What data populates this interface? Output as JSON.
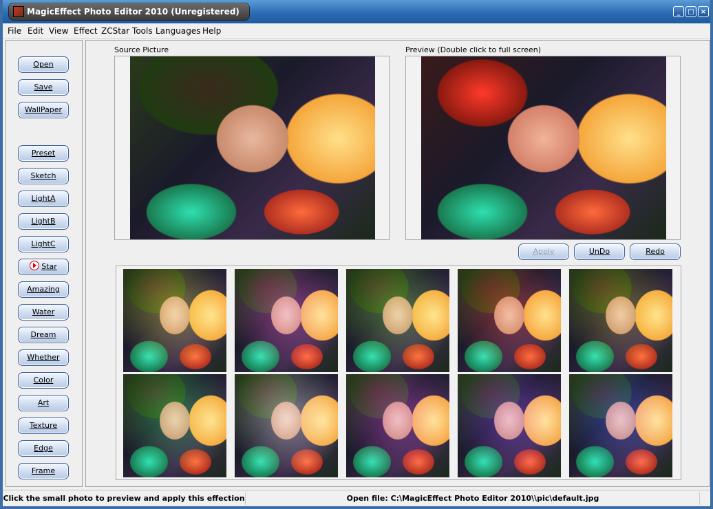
{
  "window": {
    "title": "MagicEffect Photo Editor 2010 (Unregistered)",
    "controls": [
      "_",
      "□",
      "×"
    ]
  },
  "menu": [
    {
      "label": "File"
    },
    {
      "label": "Edit"
    },
    {
      "label": "View"
    },
    {
      "label": "Effect"
    },
    {
      "label": "ZCStar Tools"
    },
    {
      "label": "Languages"
    },
    {
      "label": "Help"
    }
  ],
  "sidebar": {
    "file_buttons": [
      "Open",
      "Save",
      "WallPaper"
    ],
    "effect_buttons": [
      "Preset",
      "Sketch",
      "LightA",
      "LightB",
      "LightC",
      "Star",
      "Amazing",
      "Water",
      "Dream",
      "Whether",
      "Color",
      "Art",
      "Texture",
      "Edge",
      "Frame"
    ],
    "selected": "Star"
  },
  "source": {
    "label": "Source Picture"
  },
  "preview": {
    "label": "Preview (Double click to full screen)"
  },
  "actions": {
    "apply": "Apply",
    "undo": "UnDo",
    "redo": "Redo"
  },
  "thumbnails": [
    {
      "tint": "#f2e23c"
    },
    {
      "tint": "#ff4fd8"
    },
    {
      "tint": "#7fd43a"
    },
    {
      "tint": "#ff3a2a"
    },
    {
      "tint": "#b8a820"
    },
    {
      "tint": "#3ad45a"
    },
    {
      "tint": "#ffffff"
    },
    {
      "tint": "#d83ad8"
    },
    {
      "tint": "#8a3aff"
    },
    {
      "tint": "#3a5aff"
    }
  ],
  "status": {
    "hint": "Click the small photo to preview and apply this effection",
    "file": "Open file: C:\\MagicEffect Photo Editor 2010\\\\pic\\default.jpg"
  }
}
